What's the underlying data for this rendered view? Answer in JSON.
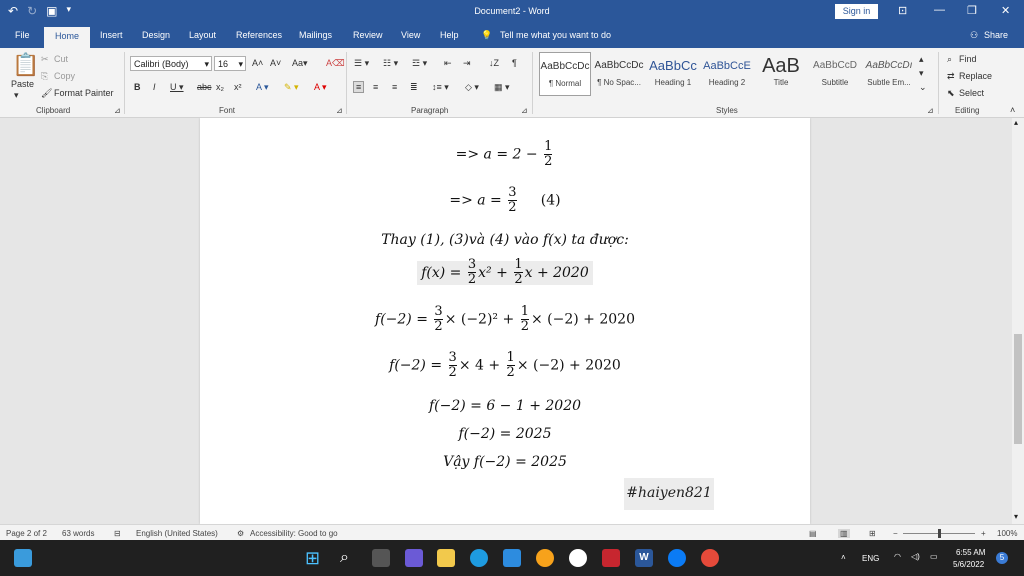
{
  "titlebar": {
    "title": "Document2 - Word",
    "signin": "Sign in"
  },
  "tabs": [
    "File",
    "Home",
    "Insert",
    "Design",
    "Layout",
    "References",
    "Mailings",
    "Review",
    "View",
    "Help"
  ],
  "tell_me": "Tell me what you want to do",
  "share": "Share",
  "clipboard": {
    "paste": "Paste",
    "cut": "Cut",
    "copy": "Copy",
    "format_painter": "Format Painter",
    "label": "Clipboard"
  },
  "font": {
    "name": "Calibri (Body)",
    "size": "16",
    "label": "Font"
  },
  "paragraph_label": "Paragraph",
  "styles": {
    "items": [
      {
        "preview": "AaBbCcDc",
        "name": "¶ Normal"
      },
      {
        "preview": "AaBbCcDc",
        "name": "¶ No Spac..."
      },
      {
        "preview": "AaBbCc",
        "name": "Heading 1"
      },
      {
        "preview": "AaBbCcE",
        "name": "Heading 2"
      },
      {
        "preview": "AaB",
        "name": "Title"
      },
      {
        "preview": "AaBbCcD",
        "name": "Subtitle"
      },
      {
        "preview": "AaBbCcDı",
        "name": "Subtle Em..."
      }
    ],
    "label": "Styles"
  },
  "editing": {
    "find": "Find",
    "replace": "Replace",
    "select": "Select",
    "label": "Editing"
  },
  "doc": {
    "l1_pre": "=> a = 2 −",
    "l1_num": "1",
    "l1_den": "2",
    "l2_pre": "=> a =",
    "l2_num": "3",
    "l2_den": "2",
    "l2_post": "(4)",
    "l3": "Thay (1), (3)và (4) vào f(x) ta được:",
    "l4_pre": "f(x) =",
    "l4_n1": "3",
    "l4_d1": "2",
    "l4_mid": "x² +",
    "l4_n2": "1",
    "l4_d2": "2",
    "l4_post": "x + 2020",
    "l5_pre": "f(−2) =",
    "l5_n1": "3",
    "l5_d1": "2",
    "l5_mid": "× (−2)² +",
    "l5_n2": "1",
    "l5_d2": "2",
    "l5_post": "× (−2) + 2020",
    "l6_pre": "f(−2) =",
    "l6_n1": "3",
    "l6_d1": "2",
    "l6_mid": "× 4 +",
    "l6_n2": "1",
    "l6_d2": "2",
    "l6_post": "× (−2) + 2020",
    "l7": "f(−2) = 6 − 1 + 2020",
    "l8": "f(−2) = 2025",
    "l9": "Vậy f(−2) = 2025",
    "tag": "#haiyen821"
  },
  "status": {
    "page": "Page 2 of 2",
    "words": "63 words",
    "language": "English (United States)",
    "accessibility": "Accessibility: Good to go",
    "zoom": "100%"
  },
  "tray": {
    "lang": "ENG",
    "time": "6:55 AM",
    "date": "5/6/2022",
    "notif": "5"
  }
}
